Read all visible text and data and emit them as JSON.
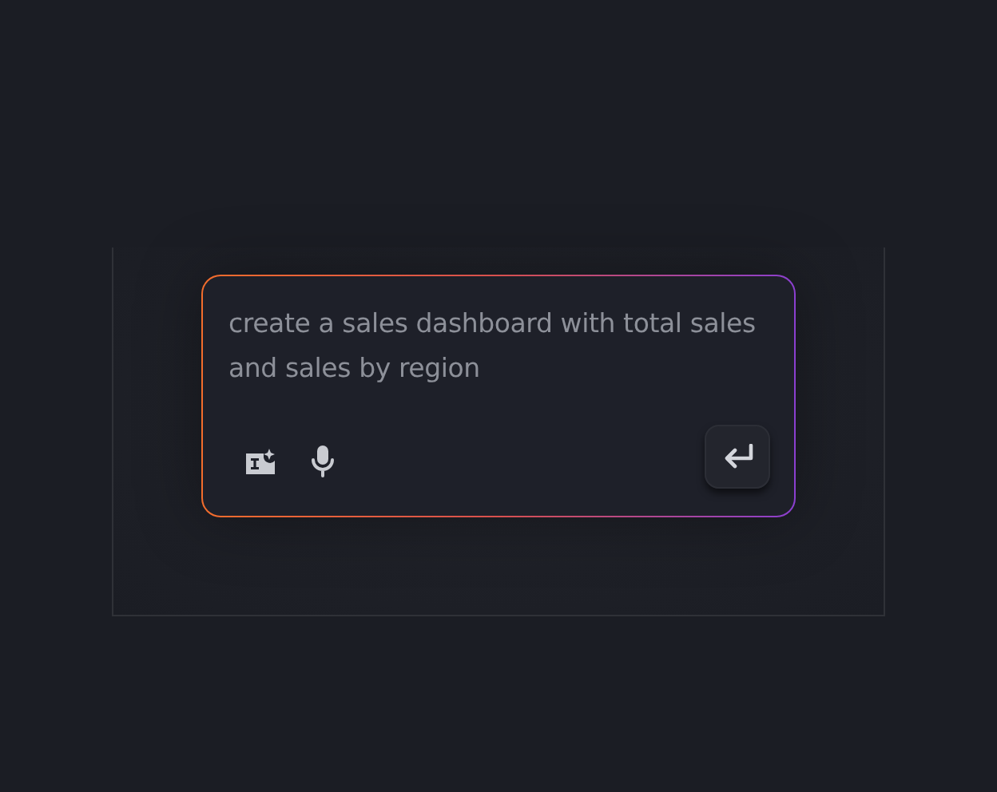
{
  "prompt": {
    "value": "create a sales dashboard with total sales and sales by region"
  }
}
